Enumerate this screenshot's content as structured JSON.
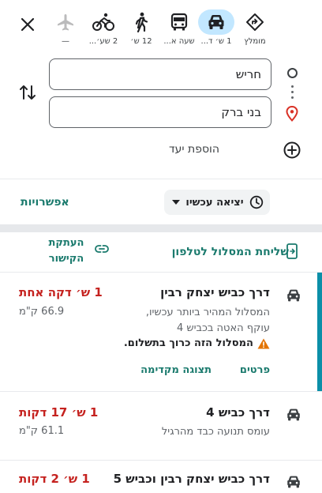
{
  "modes": [
    {
      "name": "mode-more",
      "label": "מומלץ",
      "icon": "directions-diamond-icon",
      "active": false
    },
    {
      "name": "mode-driving",
      "label": "1 ש׳ ד...",
      "icon": "car-icon",
      "active": true
    },
    {
      "name": "mode-transit",
      "label": "שעה א...",
      "icon": "bus-icon",
      "active": false
    },
    {
      "name": "mode-walking",
      "label": "12 ש׳",
      "icon": "walking-icon",
      "active": false
    },
    {
      "name": "mode-cycling",
      "label": "2 שע׳...",
      "icon": "bicycle-icon",
      "active": false
    },
    {
      "name": "mode-flight",
      "label": "—",
      "icon": "airplane-icon",
      "active": false
    }
  ],
  "origin": {
    "value": "חריש"
  },
  "destination": {
    "value": "בני ברק"
  },
  "add_stop": {
    "label": "הוספת יעד"
  },
  "options": {
    "label": "אפשרויות"
  },
  "depart": {
    "label": "יציאה עכשיו"
  },
  "send_to_phone": {
    "label": "שליחת המסלול לטלפון"
  },
  "copy_link": {
    "label": "העתקת הקישור"
  },
  "routes": [
    {
      "title": "דרך כביש יצחק רבין",
      "time": "1 ש׳ דקה אחת",
      "desc1": "המסלול המהיר ביותר עכשיו,",
      "desc2": "עוקף האטה בכביש 4",
      "distance": "66.9 ק\"מ",
      "warning": "המסלול הזה כרוך בתשלום.",
      "details": "פרטים",
      "preview": "תצוגה מקדימה"
    },
    {
      "title": "דרך כביש 4",
      "time": "1 ש׳ 17 דקות",
      "desc1": "עומס תנועה כבד מהרגיל",
      "distance": "61.1 ק\"מ"
    },
    {
      "title": "דרך כביש יצחק רבין וכביש 5",
      "time": "1 ש׳ 2 דקות"
    }
  ],
  "colors": {
    "accent_teal": "#1a7a6d",
    "active_mode_bg": "#c2e7ff",
    "time_red": "#c5221f",
    "active_route_bar": "#0b8fa8"
  }
}
